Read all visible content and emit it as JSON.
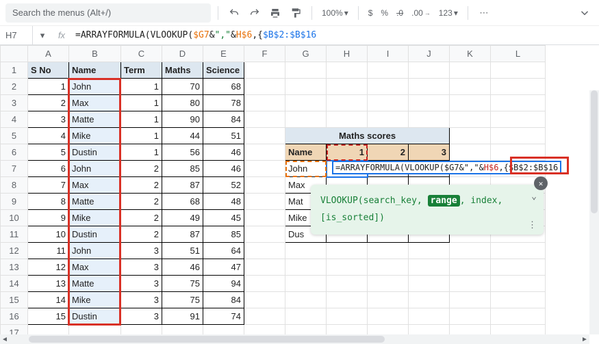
{
  "toolbar": {
    "search_placeholder": "Search the menus (Alt+/)",
    "zoom": "100%",
    "currency": "$",
    "percent": "%",
    "dec_dec": ".0",
    "dec_inc": ".00",
    "format": "123"
  },
  "formula_bar": {
    "name_box": "H7",
    "fx": "fx",
    "parts": {
      "p1": "=ARRAYFORMULA(",
      "p2": "VLOOKUP(",
      "p3": "$G7",
      "p4": "&",
      "p5": "\",\"",
      "p6": "&",
      "p7": "H$6",
      "p8": ",{",
      "p9": "$B$2:$B$16"
    }
  },
  "columns": [
    "A",
    "B",
    "C",
    "D",
    "E",
    "F",
    "G",
    "H",
    "I",
    "J",
    "K",
    "L"
  ],
  "headers": {
    "a": "S No",
    "b": "Name",
    "c": "Term",
    "d": "Maths",
    "e": "Science"
  },
  "rows": [
    {
      "n": 1,
      "sno": "1",
      "name": "John",
      "term": "1",
      "maths": "70",
      "sci": "68"
    },
    {
      "n": 2,
      "sno": "2",
      "name": "Max",
      "term": "1",
      "maths": "80",
      "sci": "78"
    },
    {
      "n": 3,
      "sno": "3",
      "name": "Matte",
      "term": "1",
      "maths": "90",
      "sci": "84"
    },
    {
      "n": 4,
      "sno": "4",
      "name": "Mike",
      "term": "1",
      "maths": "44",
      "sci": "51"
    },
    {
      "n": 5,
      "sno": "5",
      "name": "Dustin",
      "term": "1",
      "maths": "56",
      "sci": "46"
    },
    {
      "n": 6,
      "sno": "6",
      "name": "John",
      "term": "2",
      "maths": "85",
      "sci": "46"
    },
    {
      "n": 7,
      "sno": "7",
      "name": "Max",
      "term": "2",
      "maths": "87",
      "sci": "52"
    },
    {
      "n": 8,
      "sno": "8",
      "name": "Matte",
      "term": "2",
      "maths": "68",
      "sci": "48"
    },
    {
      "n": 9,
      "sno": "9",
      "name": "Mike",
      "term": "2",
      "maths": "49",
      "sci": "45"
    },
    {
      "n": 10,
      "sno": "10",
      "name": "Dustin",
      "term": "2",
      "maths": "87",
      "sci": "85"
    },
    {
      "n": 11,
      "sno": "11",
      "name": "John",
      "term": "3",
      "maths": "51",
      "sci": "64"
    },
    {
      "n": 12,
      "sno": "12",
      "name": "Max",
      "term": "3",
      "maths": "46",
      "sci": "47"
    },
    {
      "n": 13,
      "sno": "13",
      "name": "Matte",
      "term": "3",
      "maths": "75",
      "sci": "94"
    },
    {
      "n": 14,
      "sno": "14",
      "name": "Mike",
      "term": "3",
      "maths": "75",
      "sci": "84"
    },
    {
      "n": 15,
      "sno": "15",
      "name": "Dustin",
      "term": "3",
      "maths": "91",
      "sci": "74"
    }
  ],
  "pivot": {
    "title": "Maths scores",
    "name_h": "Name",
    "c1": "1",
    "c2": "2",
    "c3": "3",
    "names": [
      "John",
      "Max",
      "Mat",
      "Mike",
      "Dus"
    ],
    "names_full": [
      "John",
      "Max",
      "Matt",
      "Mike",
      "Dust"
    ]
  },
  "inline_formula": {
    "p1": "=ARRAYFORMULA(",
    "p2": "VLOOKUP(",
    "p3": "$G7",
    "p4": "&",
    "p5": "\",\"",
    "p6": "&",
    "p7": "H$6",
    "p8": ",{",
    "p9": "$B$2:$B$16"
  },
  "tooltip": {
    "fn": "VLOOKUP(",
    "a1": "search_key",
    "sep1": ", ",
    "a2": "range",
    "sep2": ", ",
    "a3": "index",
    "sep3": ",",
    "a4": "[is_sorted]",
    "end": ")"
  }
}
